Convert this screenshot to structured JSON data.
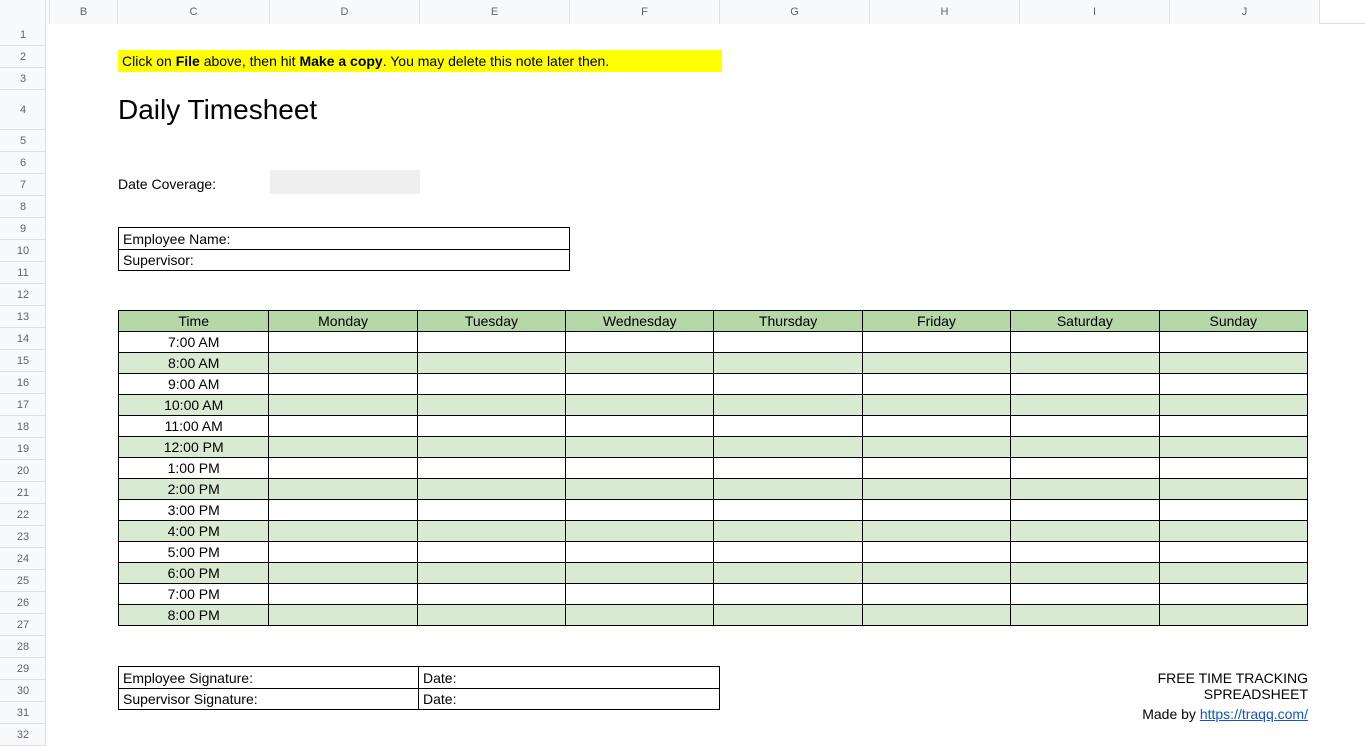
{
  "columns": [
    "B",
    "C",
    "D",
    "E",
    "F",
    "G",
    "H",
    "I",
    "J"
  ],
  "rowCount": 32,
  "note": {
    "pre": "Click on ",
    "b1": "File",
    "mid": " above, then hit ",
    "b2": "Make a copy",
    "post": ". You may delete this note later then."
  },
  "title": "Daily Timesheet",
  "dateCoverageLabel": "Date Coverage:",
  "info": {
    "employeeName": "Employee Name:",
    "supervisor": "Supervisor:"
  },
  "tsHeaders": [
    "Time",
    "Monday",
    "Tuesday",
    "Wednesday",
    "Thursday",
    "Friday",
    "Saturday",
    "Sunday"
  ],
  "times": [
    "7:00 AM",
    "8:00 AM",
    "9:00 AM",
    "10:00 AM",
    "11:00 AM",
    "12:00 PM",
    "1:00 PM",
    "2:00 PM",
    "3:00 PM",
    "4:00 PM",
    "5:00 PM",
    "6:00 PM",
    "7:00 PM",
    "8:00 PM"
  ],
  "sig": {
    "empSig": "Employee Signature:",
    "supSig": "Supervisor Signature:",
    "date": "Date:"
  },
  "footer": {
    "line1": "FREE TIME TRACKING SPREADSHEET",
    "madeBy": "Made by ",
    "url": "https://traqq.com/"
  }
}
